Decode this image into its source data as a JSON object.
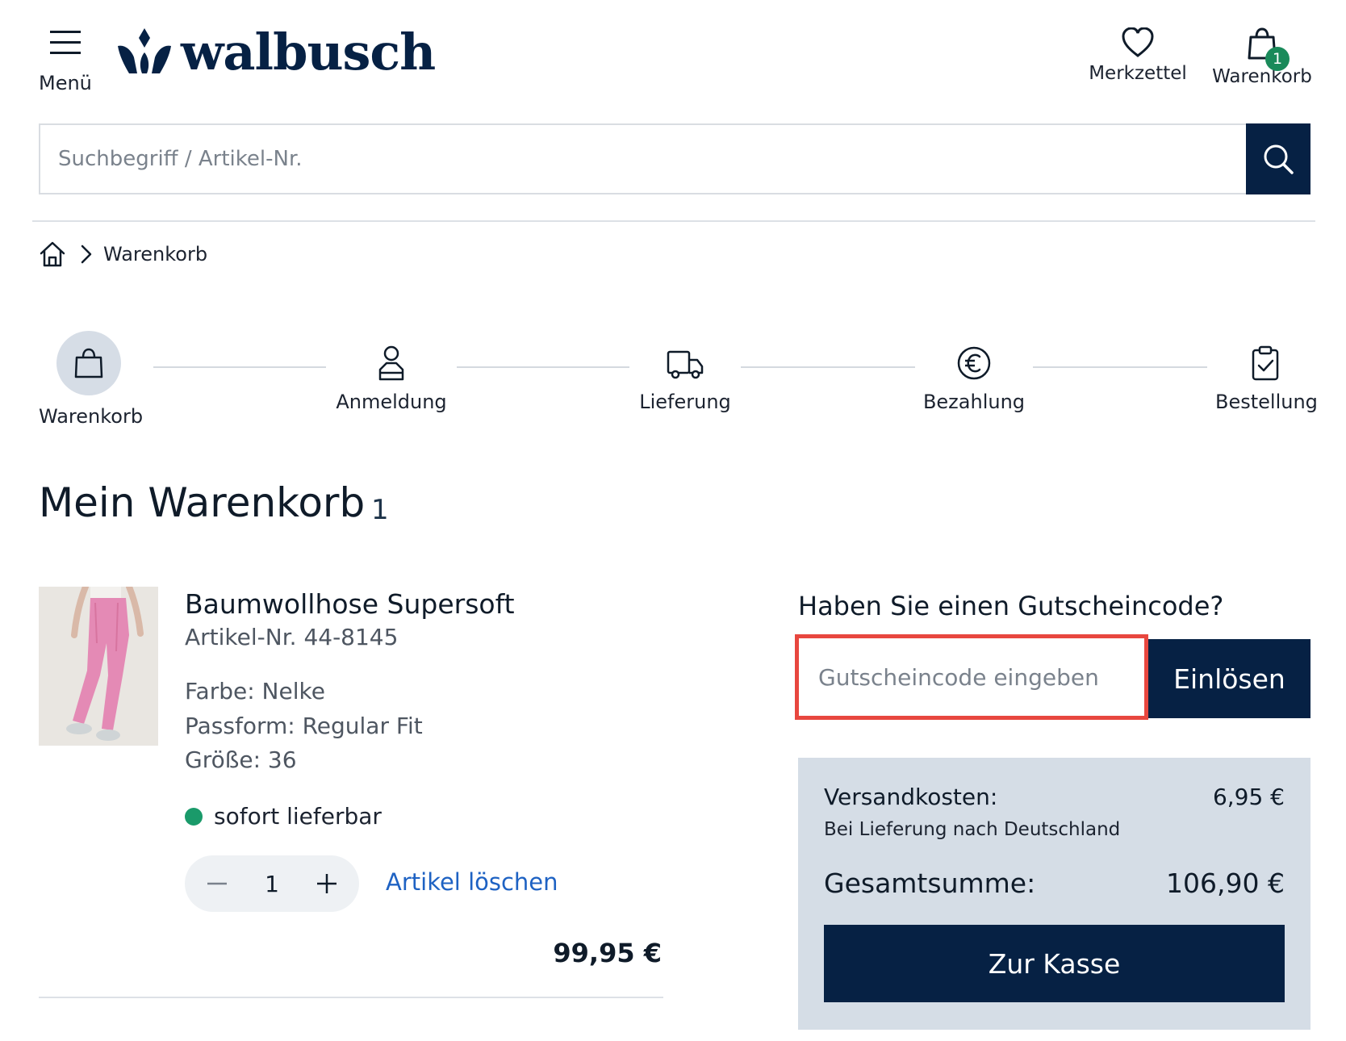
{
  "header": {
    "menu_label": "Menü",
    "logo_text": "walbusch",
    "wishlist_label": "Merkzettel",
    "cart_label": "Warenkorb",
    "cart_count": "1"
  },
  "search": {
    "placeholder": "Suchbegriff / Artikel-Nr."
  },
  "breadcrumb": {
    "current": "Warenkorb"
  },
  "steps": [
    {
      "label": "Warenkorb",
      "icon": "shopping-bag-icon",
      "active": true
    },
    {
      "label": "Anmeldung",
      "icon": "user-login-icon",
      "active": false
    },
    {
      "label": "Lieferung",
      "icon": "delivery-truck-icon",
      "active": false
    },
    {
      "label": "Bezahlung",
      "icon": "euro-icon",
      "active": false
    },
    {
      "label": "Bestellung",
      "icon": "clipboard-check-icon",
      "active": false
    }
  ],
  "page": {
    "title": "Mein Warenkorb",
    "item_count": "1"
  },
  "product": {
    "name": "Baumwollhose Supersoft",
    "article_no": "Artikel-Nr. 44-8145",
    "color": "Farbe: Nelke",
    "fit": "Passform: Regular Fit",
    "size": "Größe: 36",
    "availability": "sofort lieferbar",
    "quantity": "1",
    "delete_label": "Artikel löschen",
    "price": "99,95 €"
  },
  "voucher": {
    "question": "Haben Sie einen Gutscheincode?",
    "placeholder": "Gutscheincode eingeben",
    "redeem_label": "Einlösen"
  },
  "summary": {
    "shipping_label": "Versandkosten:",
    "shipping_value": "6,95 €",
    "shipping_note": "Bei Lieferung nach Deutschland",
    "total_label": "Gesamtsumme:",
    "total_value": "106,90 €",
    "checkout_label": "Zur Kasse"
  },
  "colors": {
    "brand_navy": "#062144",
    "available_green": "#1a9a6a",
    "link_blue": "#1e62c3",
    "highlight_red": "#e8473f",
    "summary_bg": "#d5dde6"
  }
}
